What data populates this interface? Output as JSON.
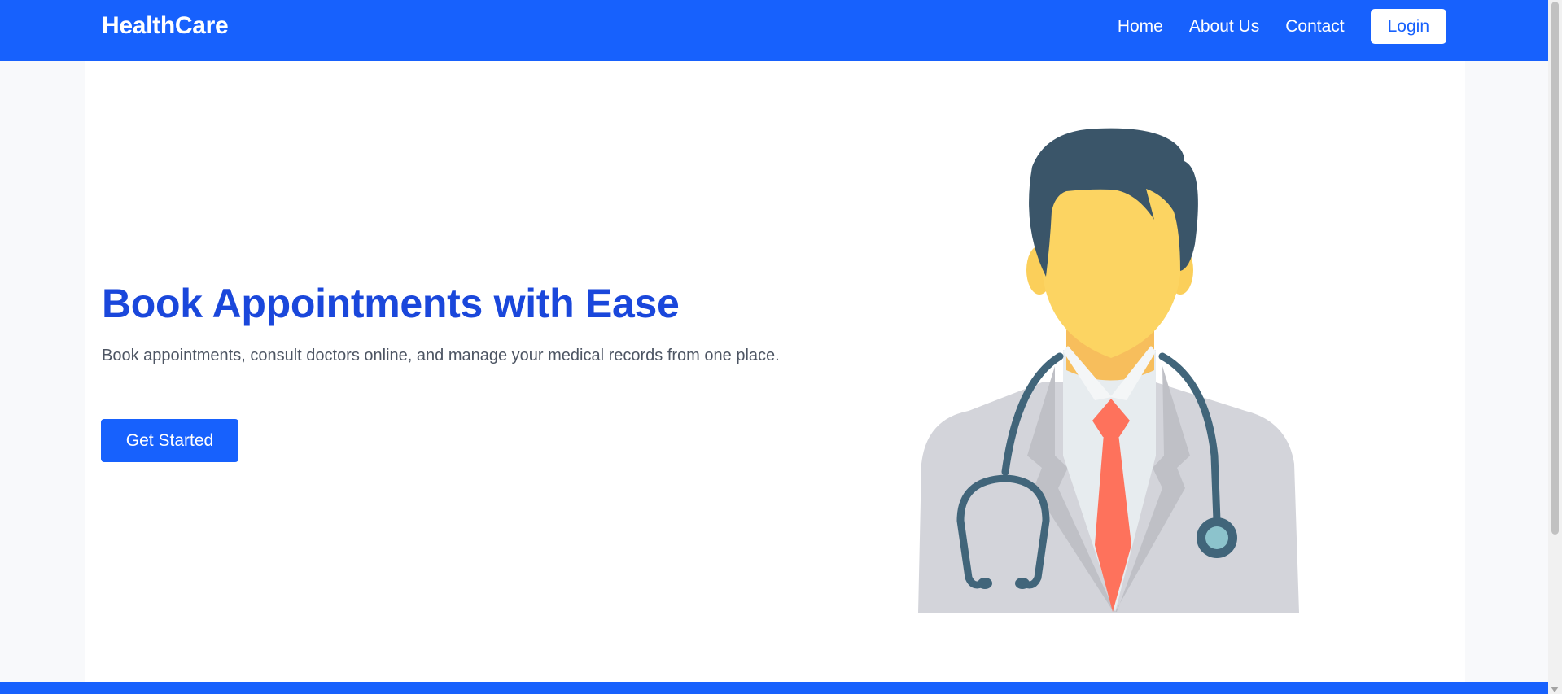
{
  "navbar": {
    "brand": "HealthCare",
    "links": [
      "Home",
      "About Us",
      "Contact"
    ],
    "login_label": "Login"
  },
  "hero": {
    "title": "Book Appointments with Ease",
    "subtitle": "Book appointments, consult doctors online, and manage your medical records from one place.",
    "cta_label": "Get Started",
    "illustration": "doctor-illustration"
  },
  "colors": {
    "primary": "#1761fd",
    "title": "#1a47db",
    "body_text": "#4d5563",
    "page_bg": "#f8f9fb",
    "panel_bg": "#ffffff"
  }
}
